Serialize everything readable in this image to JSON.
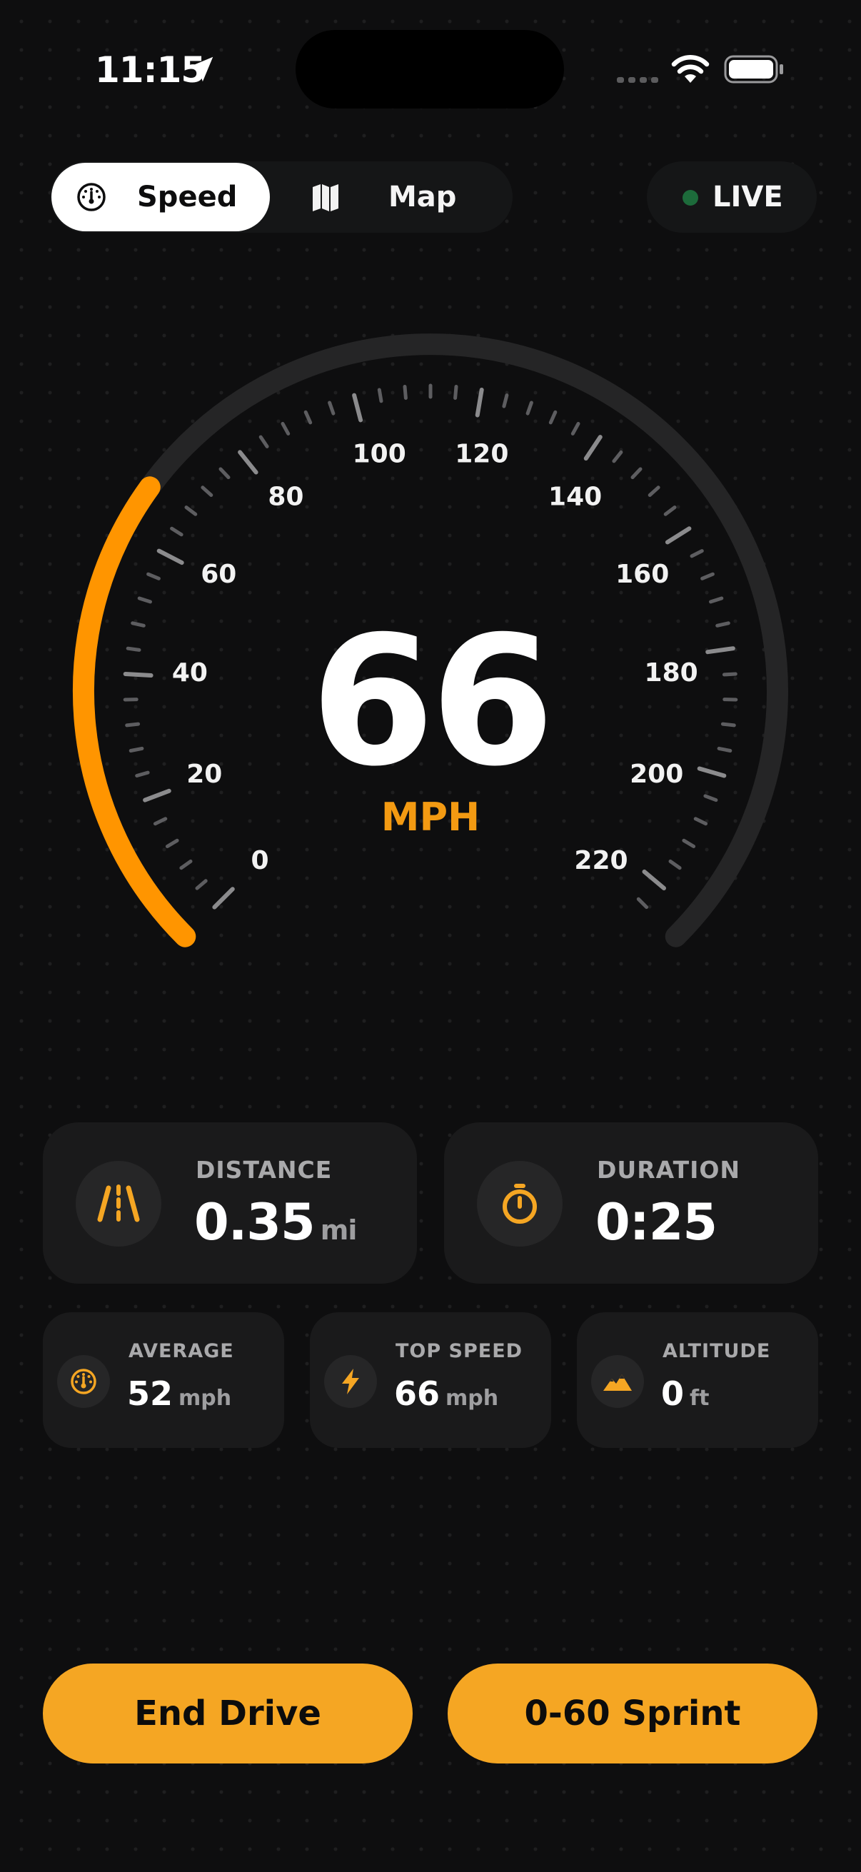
{
  "status_bar": {
    "time": "11:15"
  },
  "mode_tabs": [
    {
      "label": "Speed",
      "icon": "speedometer-icon",
      "selected": true
    },
    {
      "label": "Map",
      "icon": "map-icon",
      "selected": false
    }
  ],
  "live_indicator": {
    "label": "LIVE",
    "dot_color": "#1d6b3b"
  },
  "gauge": {
    "speed": "66",
    "unit": "MPH",
    "min": 0,
    "max": 220,
    "current_value": 66,
    "tick_labels": [
      "0",
      "20",
      "40",
      "60",
      "80",
      "100",
      "120",
      "140",
      "160",
      "180",
      "200",
      "220"
    ],
    "accent_color": "#ff9500",
    "track_color": "#252526"
  },
  "stats": {
    "distance": {
      "title": "DISTANCE",
      "value": "0.35",
      "unit": "mi",
      "icon": "road-icon"
    },
    "duration": {
      "title": "DURATION",
      "value": "0:25",
      "icon": "stopwatch-icon"
    },
    "average": {
      "title": "AVERAGE",
      "value": "52",
      "unit": "mph",
      "icon": "gauge-icon"
    },
    "top_speed": {
      "title": "TOP SPEED",
      "value": "66",
      "unit": "mph",
      "icon": "lightning-icon"
    },
    "altitude": {
      "title": "ALTITUDE",
      "value": "0",
      "unit": "ft",
      "icon": "mountains-icon"
    }
  },
  "buttons": {
    "end_drive": "End Drive",
    "sprint": "0-60 Sprint"
  },
  "colors": {
    "accent": "#f5a623",
    "icon_accent": "#f5a623",
    "background": "#0e0e0f",
    "card": "#1a1a1b"
  }
}
